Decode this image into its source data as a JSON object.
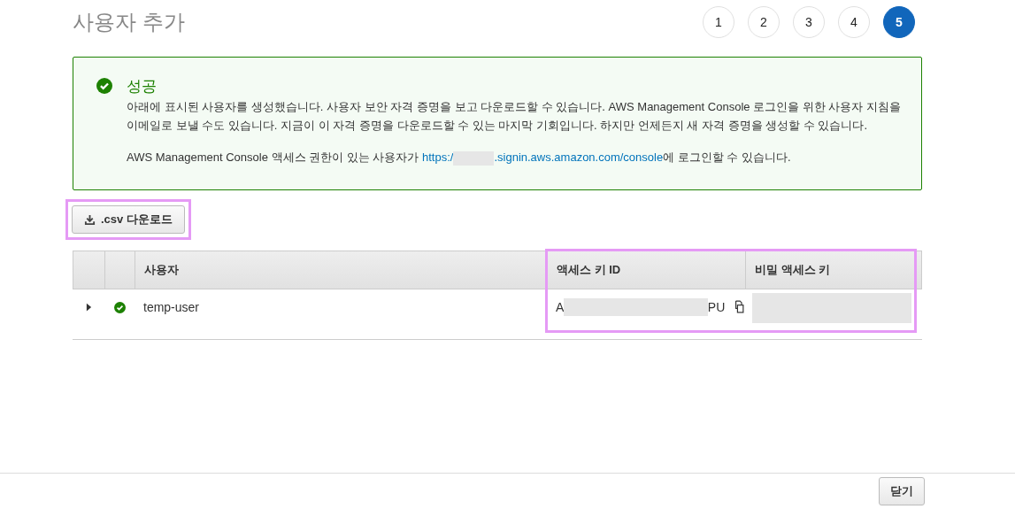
{
  "page": {
    "title": "사용자 추가"
  },
  "steps": [
    {
      "label": "1",
      "selected": false
    },
    {
      "label": "2",
      "selected": false
    },
    {
      "label": "3",
      "selected": false
    },
    {
      "label": "4",
      "selected": false
    },
    {
      "label": "5",
      "selected": true
    }
  ],
  "alert": {
    "kind": "success",
    "title": "성공",
    "message": "아래에 표시된 사용자를 생성했습니다. 사용자 보안 자격 증명을 보고 다운로드할 수 있습니다. AWS Management Console 로그인을 위한 사용자 지침을 이메일로 보낼 수도 있습니다. 지금이 이 자격 증명을 다운로드할 수 있는 마지막 기회입니다. 하지만 언제든지 새 자격 증명을 생성할 수 있습니다.",
    "console_text_before": "AWS Management Console 액세스 권한이 있는 사용자가 ",
    "link_start": "https:/",
    "link_end": ".signin.aws.amazon.com/console",
    "console_text_after": "에 로그인할 수 있습니다."
  },
  "download_button": ".csv 다운로드",
  "table": {
    "columns": [
      "사용자",
      "액세스 키 ID",
      "비밀 액세스 키"
    ],
    "rows": [
      {
        "user": "temp-user",
        "expanded": false,
        "succeeded": true,
        "access_key_start": "A",
        "access_key_end": "PU"
      }
    ]
  },
  "footer": {
    "close_button": "닫기"
  }
}
